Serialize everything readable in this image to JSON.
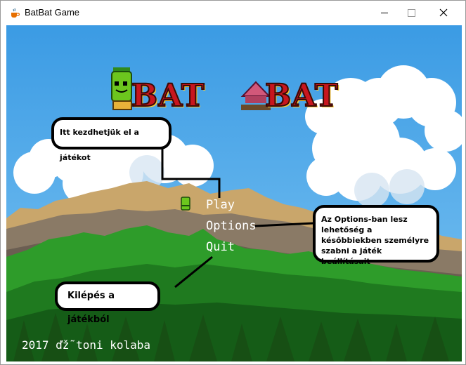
{
  "window": {
    "title": "BatBat Game",
    "minimize_glyph": "—",
    "maximize_glyph": "☐",
    "close_glyph": "✕",
    "icon": "java-cup-icon"
  },
  "logo": {
    "word1": "BAT",
    "word2": "BAT"
  },
  "menu": {
    "items": [
      {
        "label": "Play"
      },
      {
        "label": "Options"
      },
      {
        "label": "Quit"
      }
    ],
    "selector_icon": "green-bat-icon"
  },
  "callouts": {
    "play": "Itt kezdhetjük el a játékot",
    "options": "Az Options-ban lesz lehetőség a későbbiekben személyre szabni a játék beállításait",
    "quit": "Kilépés a játékból"
  },
  "footer": {
    "copyright": "2017 ďž˜toni kolaba"
  },
  "colors": {
    "sky": "#4fa9e8",
    "text": "#ffffff",
    "callout_border": "#000000"
  }
}
